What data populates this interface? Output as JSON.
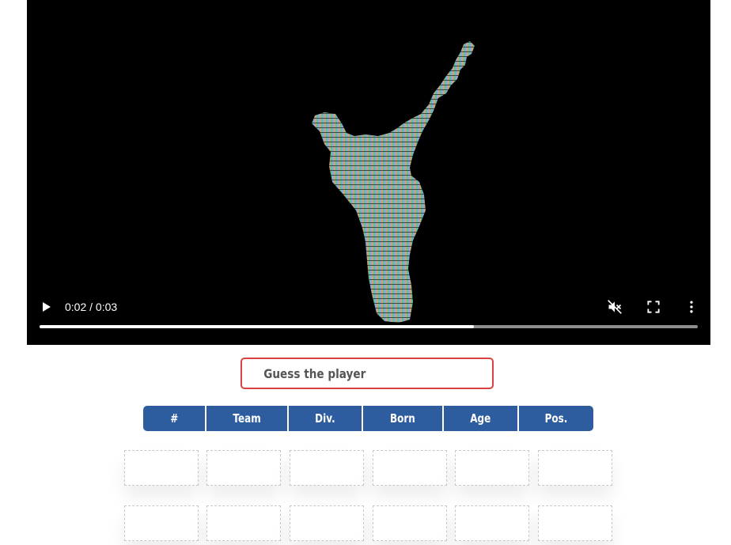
{
  "video": {
    "time_display": "0:02 / 0:03",
    "progress_fraction": 0.66,
    "controls": {
      "play_icon": "play-icon",
      "mute_icon": "volume-muted-icon",
      "fullscreen_icon": "fullscreen-icon",
      "more_icon": "more-vert-icon"
    }
  },
  "guess": {
    "placeholder": "Guess the player"
  },
  "table": {
    "headers": [
      "#",
      "Team",
      "Div.",
      "Born",
      "Age",
      "Pos."
    ],
    "rows": [
      [
        "",
        "",
        "",
        "",
        "",
        ""
      ],
      [
        "",
        "",
        "",
        "",
        "",
        ""
      ]
    ]
  },
  "colors": {
    "accent": "#2d5d9e",
    "input_border": "#d94242",
    "video_bg": "#000000"
  }
}
